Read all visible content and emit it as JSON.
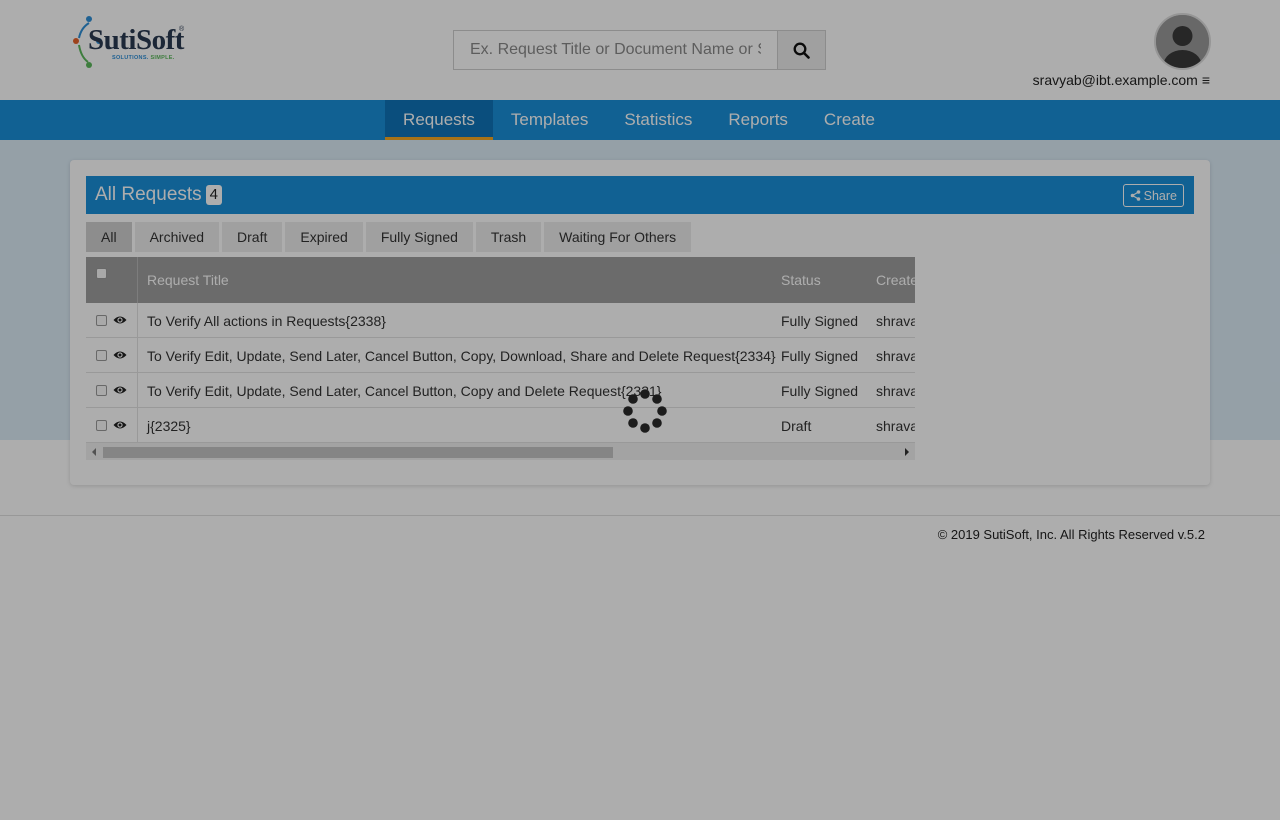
{
  "header": {
    "logo_text": "SutiSoft",
    "logo_tag_a": "SOLUTIONS.",
    "logo_tag_b": "SIMPLE.",
    "logo_reg": "®",
    "search_placeholder": "Ex. Request Title or Document Name or S",
    "search_icon": "search-icon",
    "user_email": "sravyab@ibt.example.com",
    "menu_icon": "hamburger-icon",
    "menu_glyph": "≡"
  },
  "nav": {
    "items": [
      {
        "label": "Requests",
        "active": true
      },
      {
        "label": "Templates",
        "active": false
      },
      {
        "label": "Statistics",
        "active": false
      },
      {
        "label": "Reports",
        "active": false
      },
      {
        "label": "Create",
        "active": false
      }
    ]
  },
  "panel": {
    "title": "All Requests",
    "count": "4",
    "share_label": "Share"
  },
  "tabs": [
    {
      "label": "All",
      "active": true
    },
    {
      "label": "Archived",
      "active": false
    },
    {
      "label": "Draft",
      "active": false
    },
    {
      "label": "Expired",
      "active": false
    },
    {
      "label": "Fully Signed",
      "active": false
    },
    {
      "label": "Trash",
      "active": false
    },
    {
      "label": "Waiting For Others",
      "active": false
    }
  ],
  "table": {
    "columns": [
      "Request Title",
      "Status",
      "Create"
    ],
    "rows": [
      {
        "title": "To Verify All actions in Requests{2338}",
        "status": "Fully Signed",
        "creator": "shrava"
      },
      {
        "title": "To Verify Edit, Update, Send Later, Cancel Button, Copy, Download, Share and Delete Request{2334}",
        "status": "Fully Signed",
        "creator": "shrava"
      },
      {
        "title": "To Verify Edit, Update, Send Later, Cancel Button, Copy and Delete Request{2331}",
        "status": "Fully Signed",
        "creator": "shrava"
      },
      {
        "title": "j{2325}",
        "status": "Draft",
        "creator": "shrava"
      }
    ]
  },
  "footer": {
    "copyright": "© 2019 SutiSoft, Inc. All Rights Reserved v.5.2"
  },
  "colors": {
    "nav_blue": "#1a8fd9",
    "nav_active": "#0f74b8",
    "accent_orange": "#f7a823",
    "overlay": "rgba(0,0,0,0.32)"
  }
}
